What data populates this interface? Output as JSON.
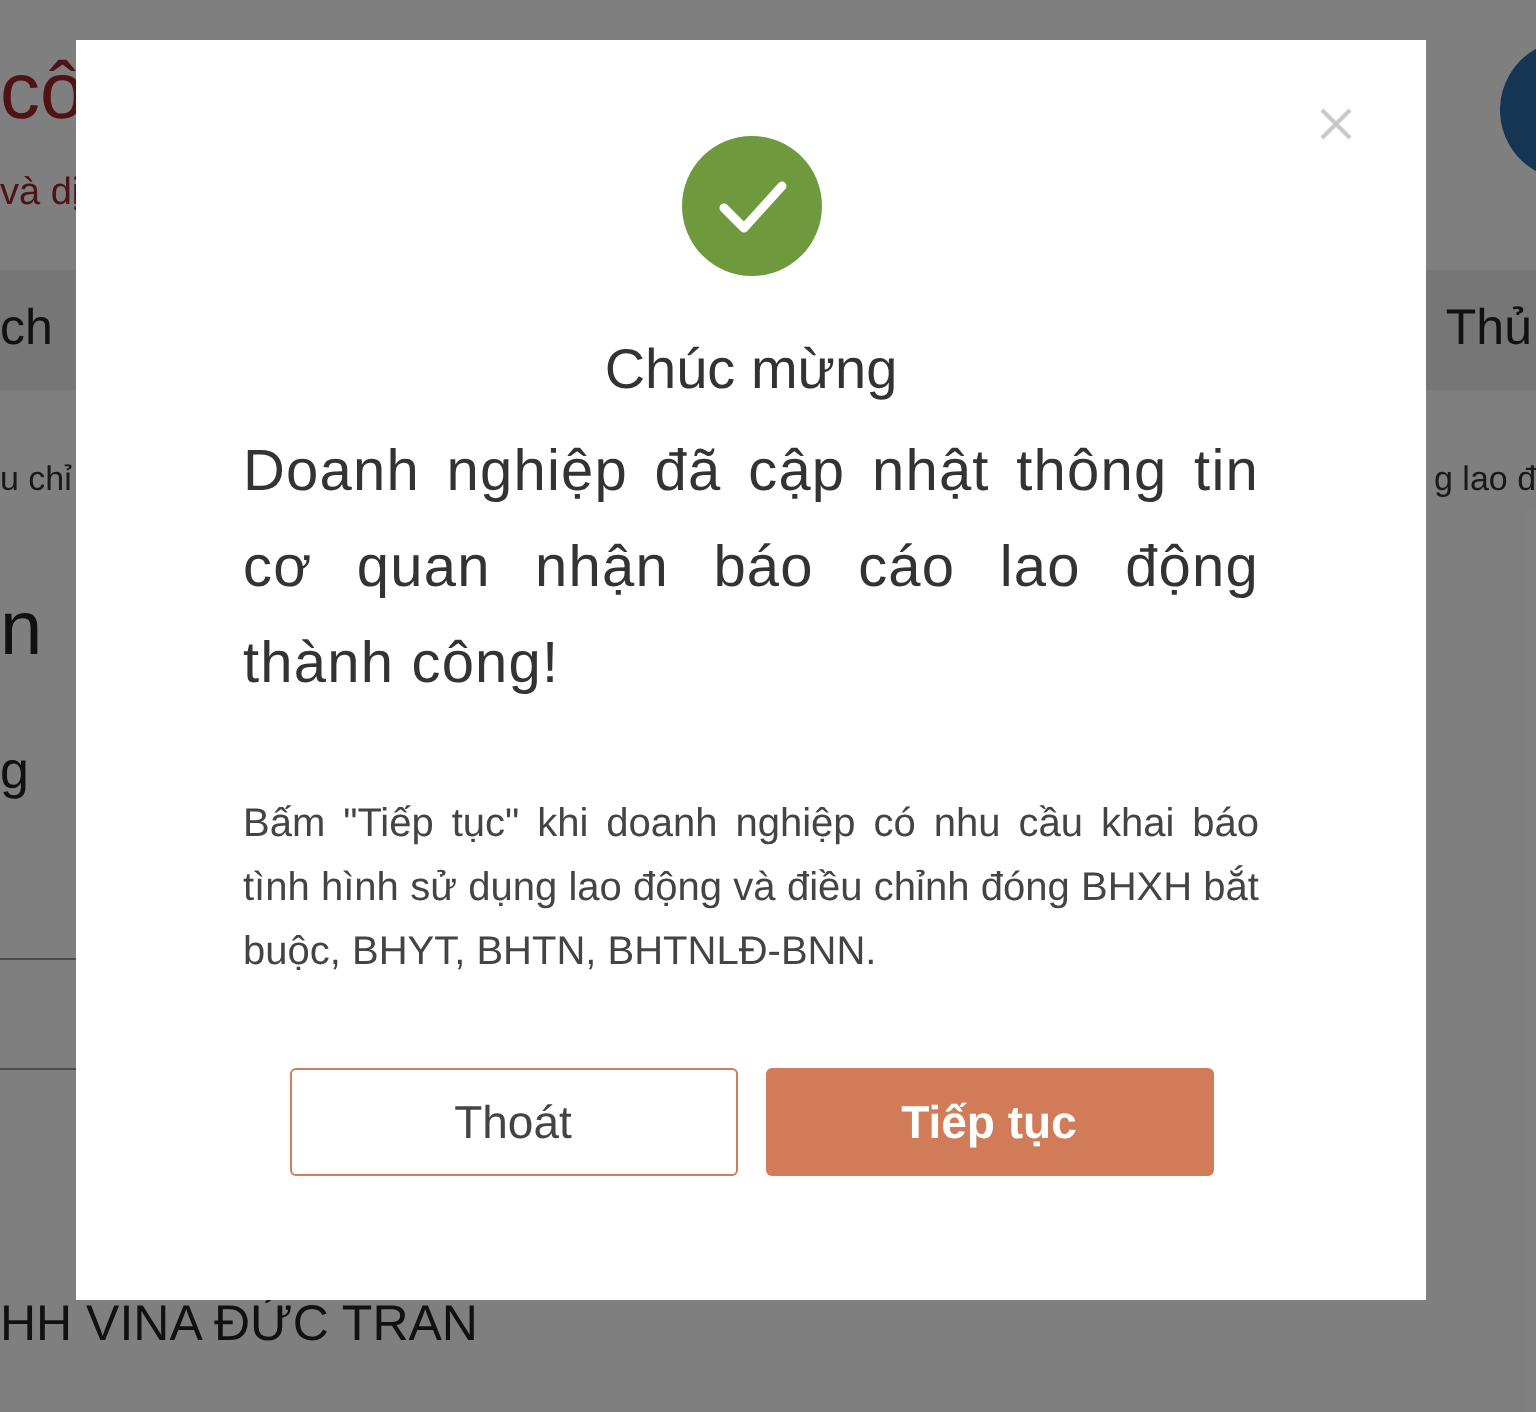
{
  "background": {
    "header_title": "cô",
    "header_subtitle": "và dị",
    "nav_left": "ch",
    "nav_right": "Thủ",
    "breadcrumb_left": "u chỉ",
    "breadcrumb_right": "g lao đ",
    "heading": "n",
    "label": "g",
    "company": "HH VINA ĐỨC TRAN"
  },
  "dialog": {
    "title": "Chúc mừng",
    "message": "Doanh nghiệp đã cập nhật thông tin cơ quan nhận báo cáo lao động thành công!",
    "note": "Bấm \"Tiếp tục\" khi doanh nghiệp có nhu cầu khai báo tình hình sử dụng lao động và điều chỉnh đóng BHXH bắt buộc, BHYT, BHTN, BHTNLĐ-BNN.",
    "buttons": [
      {
        "label": "Thoát",
        "kind": "secondary"
      },
      {
        "label": "Tiếp tục",
        "kind": "primary"
      }
    ]
  }
}
